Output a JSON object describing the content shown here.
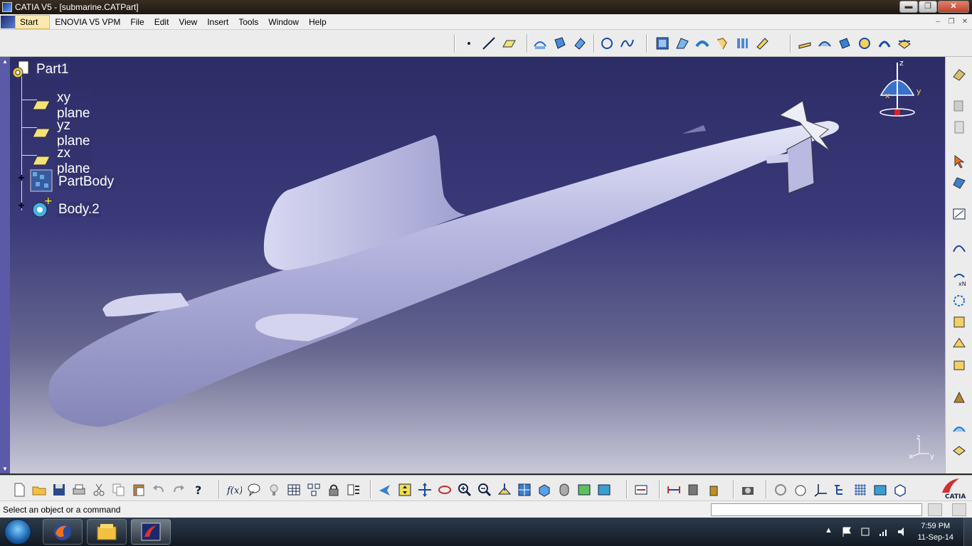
{
  "window": {
    "title": "CATIA V5 - [submarine.CATPart]",
    "min_glyph": "▬",
    "max_glyph": "❐",
    "close_glyph": "✕"
  },
  "menu": {
    "items": [
      "Start",
      "ENOVIA V5 VPM",
      "File",
      "Edit",
      "View",
      "Insert",
      "Tools",
      "Window",
      "Help"
    ],
    "mdi_min": "–",
    "mdi_restore": "❐",
    "mdi_close": "✕"
  },
  "tree": {
    "root": "Part1",
    "children": [
      "xy plane",
      "yz plane",
      "zx plane",
      "PartBody",
      "Body.2"
    ],
    "expander": "+"
  },
  "compass_labels": {
    "z": "z",
    "x": "x",
    "y": "y"
  },
  "axis_labels": {
    "z": "z",
    "x": "x",
    "y": "y"
  },
  "status": {
    "message": "Select an object or a command",
    "command_input": ""
  },
  "taskbar": {
    "time": "7:59 PM",
    "date": "11-Sep-14",
    "tray_up": "▲"
  },
  "colors": {
    "viewport_top": "#2c2c66",
    "viewport_bottom": "#c8c8d8",
    "model": "#b8b8e0",
    "start_highlight": "#fde9b0"
  }
}
